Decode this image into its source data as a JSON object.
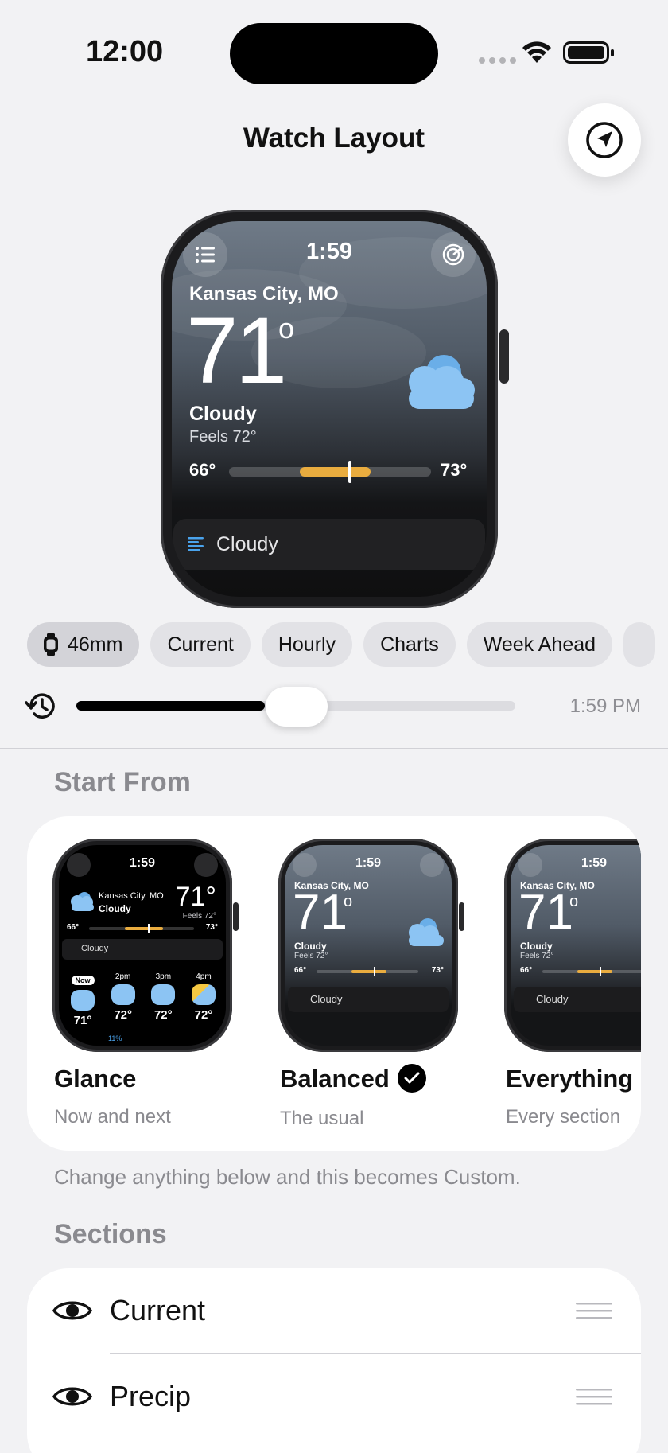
{
  "status_bar": {
    "time": "12:00"
  },
  "header": {
    "title": "Watch Layout",
    "location_icon": "location-arrow-icon"
  },
  "watch_preview": {
    "time": "1:59",
    "city": "Kansas City, MO",
    "temp": "71",
    "degree": "o",
    "condition": "Cloudy",
    "feels": "Feels 72°",
    "low": "66°",
    "high": "73°",
    "range_fill": {
      "start": 0.35,
      "end": 0.7,
      "marker": 0.6
    },
    "summary": "Cloudy"
  },
  "chips": [
    {
      "label": "46mm",
      "icon": "watch-icon",
      "selected": true
    },
    {
      "label": "Current"
    },
    {
      "label": "Hourly"
    },
    {
      "label": "Charts"
    },
    {
      "label": "Week Ahead"
    }
  ],
  "timeline": {
    "value_label": "1:59 PM",
    "progress": 0.43
  },
  "start_from": {
    "heading": "Start From",
    "options": [
      {
        "name": "Glance",
        "subtitle": "Now and next",
        "selected": false
      },
      {
        "name": "Balanced",
        "subtitle": "The usual",
        "selected": true
      },
      {
        "name": "Everything",
        "subtitle": "Every section",
        "selected": false
      }
    ],
    "mini": {
      "time": "1:59",
      "city": "Kansas City, MO",
      "condition": "Cloudy",
      "temp": "71°",
      "temp_big": "71",
      "degree": "o",
      "feels": "Feels 72°",
      "low": "66°",
      "high": "73°",
      "summary": "Cloudy",
      "hourly": [
        {
          "time": "Now",
          "temp": "71°"
        },
        {
          "time": "2pm",
          "temp": "72°"
        },
        {
          "time": "3pm",
          "temp": "72°"
        },
        {
          "time": "4pm",
          "temp": "72°"
        }
      ],
      "precip": "11%"
    },
    "note": "Change anything below and this becomes Custom."
  },
  "sections": {
    "heading": "Sections",
    "items": [
      {
        "label": "Current"
      },
      {
        "label": "Precip"
      }
    ]
  },
  "colors": {
    "accent_bar": "#e9ac3f",
    "cloud": "#8cc4f3",
    "background": "#f2f2f4"
  }
}
